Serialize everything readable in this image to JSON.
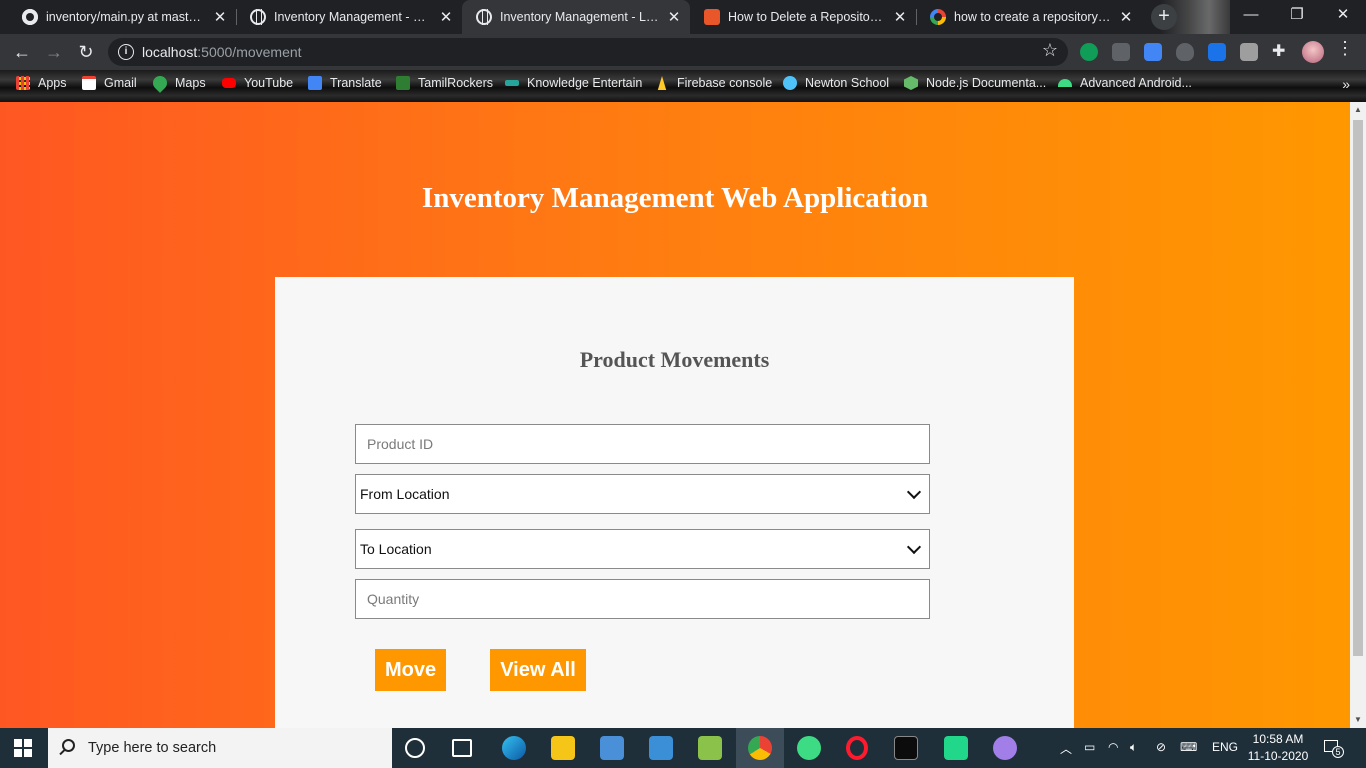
{
  "browser": {
    "tabs": [
      {
        "title": "inventory/main.py at master · N",
        "favicon": "github-icon",
        "active": false
      },
      {
        "title": "Inventory Management - Login",
        "favicon": "globe-icon",
        "active": false
      },
      {
        "title": "Inventory Management - Login",
        "favicon": "globe-icon",
        "active": true
      },
      {
        "title": "How to Delete a Repository in",
        "favicon": "gear-icon",
        "active": false
      },
      {
        "title": "how to create a repository in g",
        "favicon": "google-icon",
        "active": false
      }
    ],
    "new_tab_label": "+",
    "window_controls": {
      "minimize": "—",
      "restore": "❐",
      "close": "✕"
    },
    "address": {
      "host": "localhost",
      "path": ":5000/movement"
    }
  },
  "bookmarks": [
    {
      "label": "Apps",
      "icon": "apps-grid-icon",
      "color": "#ea4335"
    },
    {
      "label": "Gmail",
      "icon": "gmail-icon",
      "color": "#ea4335"
    },
    {
      "label": "Maps",
      "icon": "maps-pin-icon",
      "color": "#34a853"
    },
    {
      "label": "YouTube",
      "icon": "youtube-icon",
      "color": "#ff0000"
    },
    {
      "label": "Translate",
      "icon": "translate-icon",
      "color": "#4285f4"
    },
    {
      "label": "TamilRockers",
      "icon": "tamilrockers-icon",
      "color": "#2e7d32"
    },
    {
      "label": "Knowledge Entertain",
      "icon": "knowledge-icon",
      "color": "#26a69a"
    },
    {
      "label": "Firebase console",
      "icon": "firebase-icon",
      "color": "#ffca28"
    },
    {
      "label": "Newton School",
      "icon": "newton-icon",
      "color": "#4fc3f7"
    },
    {
      "label": "Node.js Documenta...",
      "icon": "nodejs-icon",
      "color": "#66bb6a"
    },
    {
      "label": "Advanced Android...",
      "icon": "android-icon",
      "color": "#3ddc84"
    }
  ],
  "bookmarks_more": "»",
  "page": {
    "title": "Inventory Management Web Application",
    "card_title": "Product Movements",
    "form": {
      "product_id_placeholder": "Product ID",
      "from_location_value": "From Location",
      "to_location_value": "To Location",
      "quantity_placeholder": "Quantity"
    },
    "buttons": {
      "move": "Move",
      "view_all": "View All"
    },
    "colors": {
      "gradient_start": "#ff5722",
      "gradient_end": "#ff9800",
      "button": "#ff9800",
      "card": "#f7f7f7"
    }
  },
  "taskbar": {
    "search_placeholder": "Type here to search",
    "language": "ENG",
    "time": "10:58 AM",
    "date": "11-10-2020",
    "notifications": "5"
  }
}
